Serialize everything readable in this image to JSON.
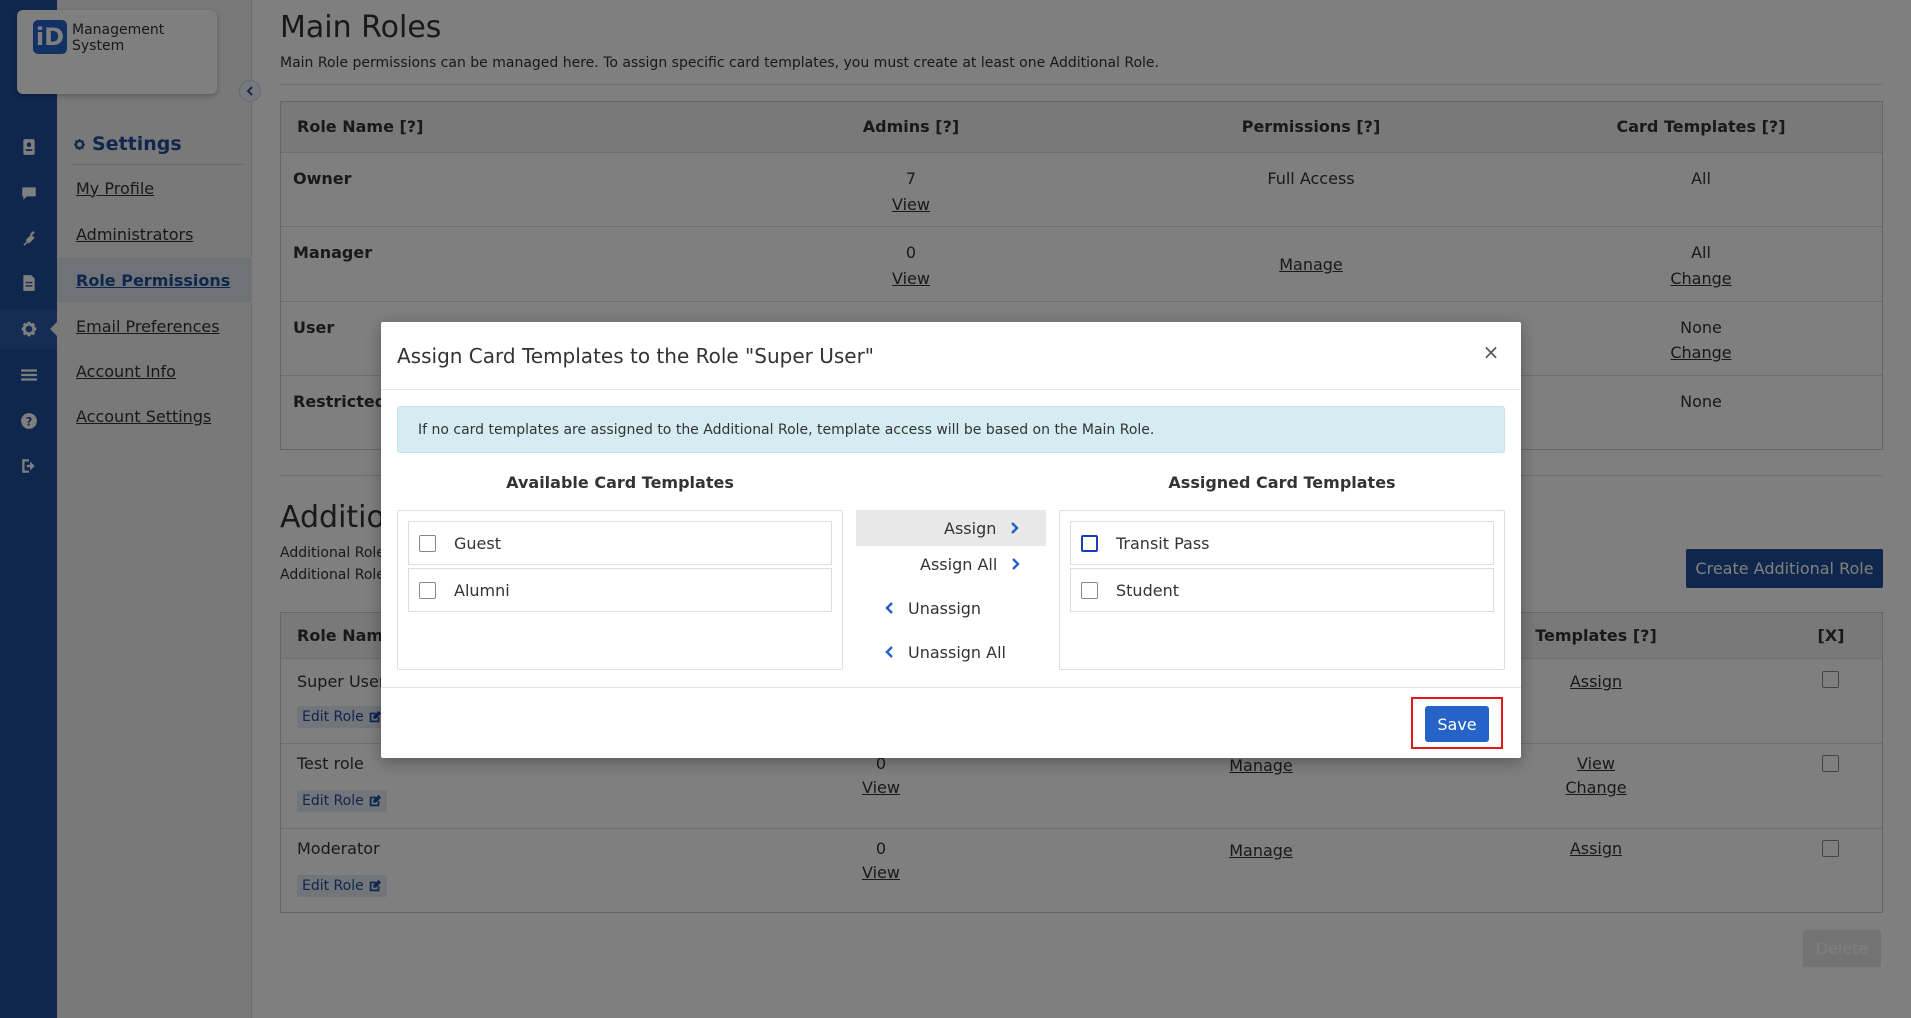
{
  "app": {
    "logo_mark": "iD",
    "logo_text": "Management System"
  },
  "colors": {
    "primary": "#1f4d9a",
    "accent": "#2563c9",
    "highlight": "#e01b1b",
    "alert_bg": "#d5ecf2"
  },
  "rail": {
    "icons": [
      "id-card-icon",
      "chat-icon",
      "plug-icon",
      "document-icon",
      "gear-icon",
      "list-icon",
      "help-icon",
      "sign-out-icon"
    ]
  },
  "subnav": {
    "title": "Settings",
    "items": [
      {
        "label": "My Profile"
      },
      {
        "label": "Administrators"
      },
      {
        "label": "Role Permissions",
        "active": true
      },
      {
        "label": "Email Preferences"
      },
      {
        "label": "Account Info"
      },
      {
        "label": "Account Settings"
      }
    ]
  },
  "main": {
    "title": "Main Roles",
    "description": "Main Role permissions can be managed here. To assign specific card templates, you must create at least one Additional Role.",
    "main_table": {
      "headers": [
        "Role Name [?]",
        "Admins [?]",
        "Permissions [?]",
        "Card Templates [?]"
      ],
      "rows": [
        {
          "name": "Owner",
          "admins": "7",
          "admins_link": "View",
          "permissions": "Full Access",
          "templates": "All",
          "templates_link": ""
        },
        {
          "name": "Manager",
          "admins": "0",
          "admins_link": "View",
          "permissions": "Manage",
          "templates": "All",
          "templates_link": "Change"
        },
        {
          "name": "User",
          "admins": "",
          "admins_link": "",
          "permissions": "",
          "templates": "None",
          "templates_link": "Change"
        },
        {
          "name": "Restricted",
          "admins": "",
          "admins_link": "",
          "permissions": "",
          "templates": "None",
          "templates_link": ""
        }
      ]
    },
    "additional_title": "Additio",
    "additional_desc_1": "Additional Roles",
    "additional_desc_2": "Additional Role.",
    "create_button": "Create Additional Role",
    "add_table": {
      "headers": [
        "Role Name",
        "Templates [?]",
        "[X]"
      ],
      "rows": [
        {
          "name": "Super User",
          "edit": "Edit Role",
          "admins": "",
          "admins_link": "",
          "permissions": "",
          "templates_1": "Assign",
          "templates_2": ""
        },
        {
          "name": "Test role",
          "edit": "Edit Role",
          "admins": "0",
          "admins_link": "View",
          "permissions": "Manage",
          "templates_1": "View",
          "templates_2": "Change"
        },
        {
          "name": "Moderator",
          "edit": "Edit Role",
          "admins": "0",
          "admins_link": "View",
          "permissions": "Manage",
          "templates_1": "Assign",
          "templates_2": ""
        }
      ]
    },
    "delete_button": "Delete"
  },
  "modal": {
    "title": "Assign Card Templates to the Role \"Super User\"",
    "close": "×",
    "alert": "If no card templates are assigned to the Additional Role, template access will be based on the Main Role.",
    "available_header": "Available Card Templates",
    "assigned_header": "Assigned Card Templates",
    "available": [
      "Guest",
      "Alumni"
    ],
    "assigned": [
      "Transit Pass",
      "Student"
    ],
    "buttons": {
      "assign": "Assign",
      "assign_all": "Assign All",
      "unassign": "Unassign",
      "unassign_all": "Unassign All"
    },
    "save": "Save"
  }
}
